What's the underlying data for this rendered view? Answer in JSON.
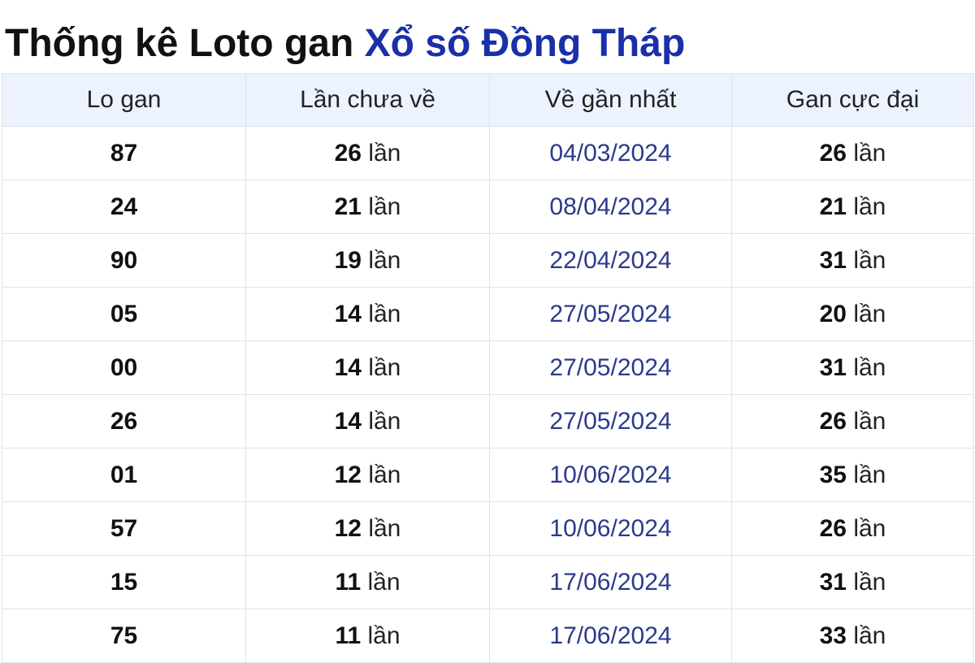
{
  "title": {
    "prefix": "Thống kê Loto gan",
    "link": "Xổ số Đồng Tháp"
  },
  "table": {
    "headers": [
      "Lo gan",
      "Lần chưa về",
      "Về gần nhất",
      "Gan cực đại"
    ],
    "unit": "lần",
    "rows": [
      {
        "lo": "87",
        "chua_ve": "26",
        "ve_gan_nhat": "04/03/2024",
        "gan_cuc_dai": "26"
      },
      {
        "lo": "24",
        "chua_ve": "21",
        "ve_gan_nhat": "08/04/2024",
        "gan_cuc_dai": "21"
      },
      {
        "lo": "90",
        "chua_ve": "19",
        "ve_gan_nhat": "22/04/2024",
        "gan_cuc_dai": "31"
      },
      {
        "lo": "05",
        "chua_ve": "14",
        "ve_gan_nhat": "27/05/2024",
        "gan_cuc_dai": "20"
      },
      {
        "lo": "00",
        "chua_ve": "14",
        "ve_gan_nhat": "27/05/2024",
        "gan_cuc_dai": "31"
      },
      {
        "lo": "26",
        "chua_ve": "14",
        "ve_gan_nhat": "27/05/2024",
        "gan_cuc_dai": "26"
      },
      {
        "lo": "01",
        "chua_ve": "12",
        "ve_gan_nhat": "10/06/2024",
        "gan_cuc_dai": "35"
      },
      {
        "lo": "57",
        "chua_ve": "12",
        "ve_gan_nhat": "10/06/2024",
        "gan_cuc_dai": "26"
      },
      {
        "lo": "15",
        "chua_ve": "11",
        "ve_gan_nhat": "17/06/2024",
        "gan_cuc_dai": "31"
      },
      {
        "lo": "75",
        "chua_ve": "11",
        "ve_gan_nhat": "17/06/2024",
        "gan_cuc_dai": "33"
      }
    ]
  },
  "colors": {
    "title_link": "#1a2fa8",
    "header_bg": "#ecf3fe",
    "date_text": "#2b3a8c",
    "border": "#dfe3ea"
  }
}
